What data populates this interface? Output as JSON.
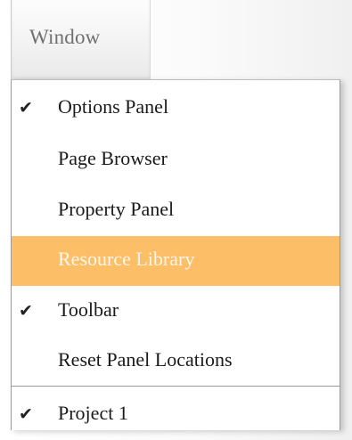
{
  "menu": {
    "title": "Window"
  },
  "items": [
    {
      "label": "Options Panel",
      "checked": true,
      "check_glyph": "✔"
    },
    {
      "label": "Page Browser",
      "checked": false
    },
    {
      "label": "Property Panel",
      "checked": false
    },
    {
      "label": "Resource Library",
      "checked": false,
      "highlighted": true
    },
    {
      "label": "Toolbar",
      "checked": true,
      "check_glyph": "✔"
    },
    {
      "label": "Reset Panel Locations",
      "checked": false
    }
  ],
  "projects": [
    {
      "label": "Project 1",
      "checked": true,
      "check_glyph": "✔"
    }
  ],
  "colors": {
    "highlight": "#fdbe68",
    "highlight_text": "#fff7ea"
  }
}
